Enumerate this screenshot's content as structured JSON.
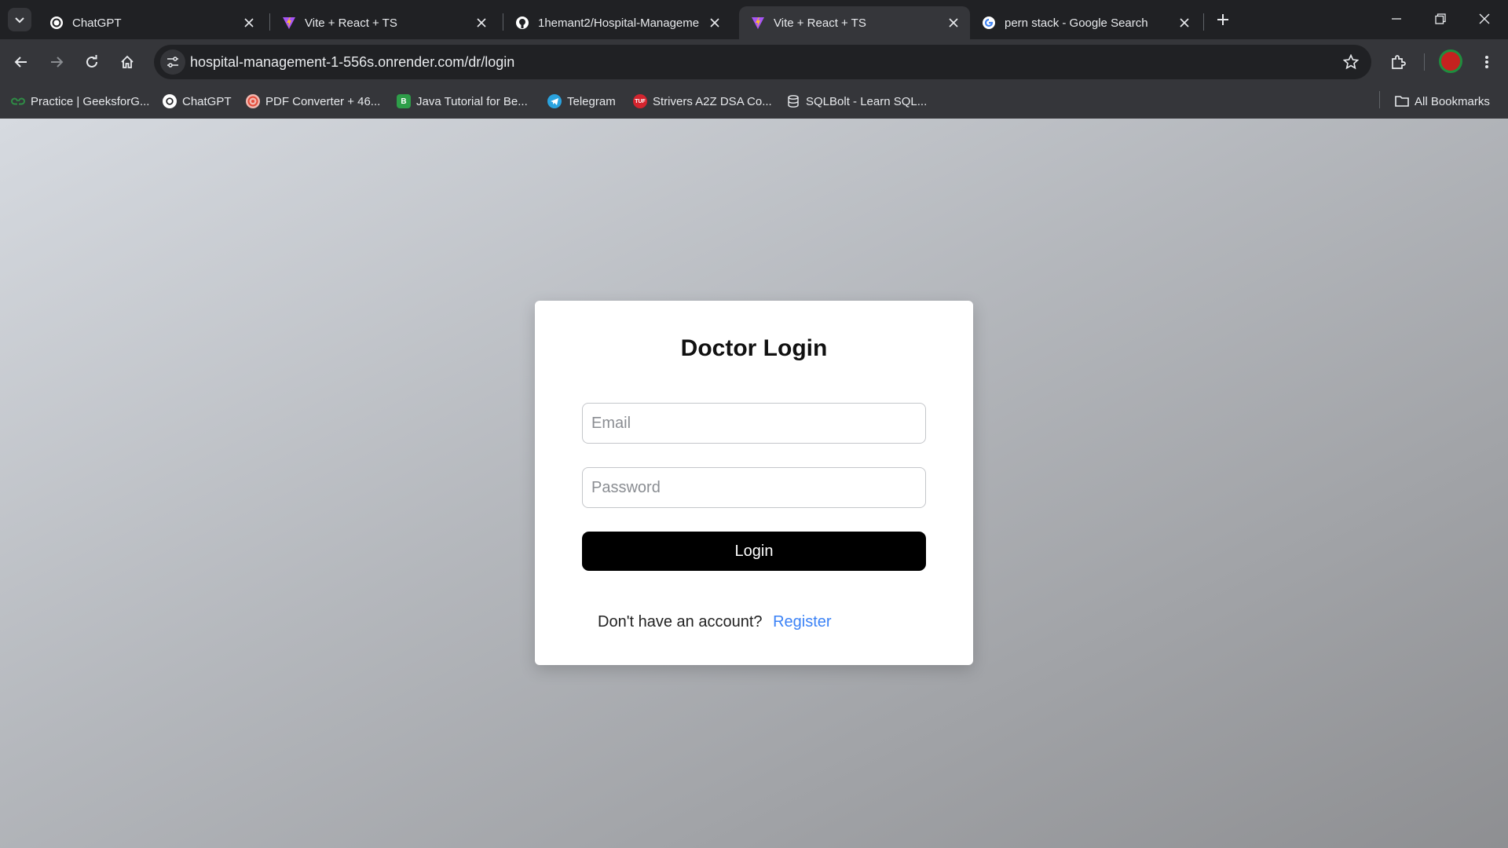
{
  "browser": {
    "tabs": [
      {
        "title": "ChatGPT",
        "icon": "chatgpt-icon",
        "active": false
      },
      {
        "title": "Vite + React + TS",
        "icon": "vite-icon",
        "active": false
      },
      {
        "title": "1hemant2/Hospital-Manageme",
        "icon": "github-icon",
        "active": false
      },
      {
        "title": "Vite + React + TS",
        "icon": "vite-icon",
        "active": true
      },
      {
        "title": "pern stack - Google Search",
        "icon": "google-icon",
        "active": false
      }
    ],
    "url": "hospital-management-1-556s.onrender.com/dr/login",
    "bookmarks": [
      {
        "label": "Practice | GeeksforG...",
        "icon": "geeksforgeeks-icon"
      },
      {
        "label": "ChatGPT",
        "icon": "chatgpt-icon"
      },
      {
        "label": "PDF Converter + 46...",
        "icon": "pdf-converter-icon"
      },
      {
        "label": "Java Tutorial for Be...",
        "icon": "java-tutorial-icon"
      },
      {
        "label": "Telegram",
        "icon": "telegram-icon"
      },
      {
        "label": "Strivers A2Z DSA Co...",
        "icon": "tuf-icon"
      },
      {
        "label": "SQLBolt - Learn SQL...",
        "icon": "sqlbolt-icon"
      }
    ],
    "all_bookmarks_label": "All Bookmarks",
    "bookmark_badges": {
      "java": "B",
      "tuf": "TUF"
    }
  },
  "colors": {
    "accent_link": "#3b82f6",
    "button_bg": "#000000",
    "vite_purple": "#a855f7",
    "vite_yellow": "#fbbf24"
  },
  "login": {
    "title": "Doctor Login",
    "email_placeholder": "Email",
    "email_value": "",
    "password_placeholder": "Password",
    "password_value": "",
    "submit_label": "Login",
    "register_prompt": "Don't have an account?",
    "register_link": "Register"
  }
}
